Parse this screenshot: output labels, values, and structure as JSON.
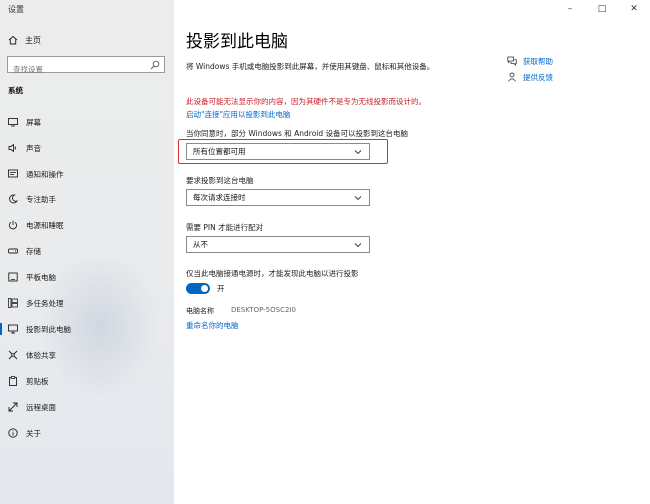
{
  "window": {
    "app_title": "设置"
  },
  "controls": {
    "minimize": "–",
    "maximize": "□",
    "close": "✕"
  },
  "sidebar": {
    "home_label": "主页",
    "search_placeholder": "查找设置",
    "section_label": "系统",
    "items": [
      {
        "label": "屏幕",
        "icon": "monitor-icon"
      },
      {
        "label": "声音",
        "icon": "speaker-icon"
      },
      {
        "label": "通知和操作",
        "icon": "notification-icon"
      },
      {
        "label": "专注助手",
        "icon": "moon-icon"
      },
      {
        "label": "电源和睡眠",
        "icon": "power-icon"
      },
      {
        "label": "存储",
        "icon": "storage-icon"
      },
      {
        "label": "平板电脑",
        "icon": "tablet-icon"
      },
      {
        "label": "多任务处理",
        "icon": "multitask-icon"
      },
      {
        "label": "投影到此电脑",
        "icon": "project-icon",
        "active": true
      },
      {
        "label": "体验共享",
        "icon": "share-icon"
      },
      {
        "label": "剪贴板",
        "icon": "clipboard-icon"
      },
      {
        "label": "远程桌面",
        "icon": "remote-desktop-icon"
      },
      {
        "label": "关于",
        "icon": "info-icon"
      }
    ]
  },
  "main": {
    "title": "投影到此电脑",
    "description": "将 Windows 手机或电脑投影到此屏幕，并使用其键盘、鼠标和其他设备。",
    "warning": "此设备可能无法显示你的内容，因为其硬件不是专为无线投影而设计的。",
    "enable_link": "启动\"连接\"应用以投影到此电脑",
    "availability": {
      "label": "当你同意时，部分 Windows 和 Android 设备可以投影到这台电脑",
      "value": "所有位置都可用"
    },
    "ask": {
      "label": "要求投影到这台电脑",
      "value": "每次请求连接时"
    },
    "pin": {
      "label": "需要 PIN 才能进行配对",
      "value": "从不"
    },
    "power": {
      "label": "仅当此电脑接通电源时，才能发现此电脑以进行投影",
      "toggle_state": "开",
      "on": true
    },
    "pc_name": {
      "key": "电脑名称",
      "value": "DESKTOP-5OSC2I0"
    },
    "rename_link": "重命名你的电脑"
  },
  "help": {
    "get_help": "获取帮助",
    "feedback": "提供反馈"
  },
  "colors": {
    "accent": "#0067c0",
    "warning": "#c8222a",
    "link": "#0066cc",
    "highlight": "#d9302f"
  }
}
